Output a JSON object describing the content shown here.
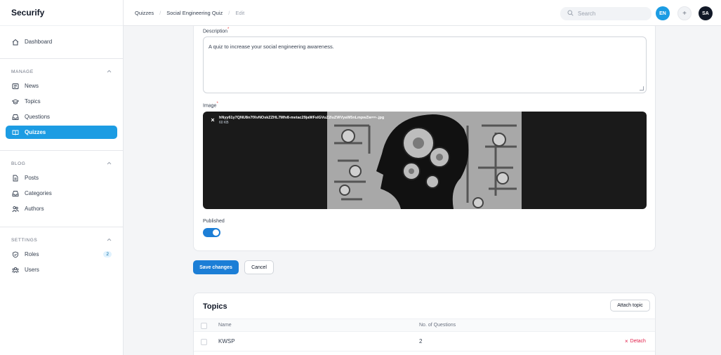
{
  "app": {
    "brand": "Securify"
  },
  "sidebar": {
    "dashboard": "Dashboard",
    "groups": [
      {
        "label": "MANAGE",
        "items": [
          "News",
          "Topics",
          "Questions",
          "Quizzes"
        ]
      },
      {
        "label": "BLOG",
        "items": [
          "Posts",
          "Categories",
          "Authors"
        ]
      },
      {
        "label": "SETTINGS",
        "items": [
          "Roles",
          "Users"
        ]
      }
    ],
    "roles_badge": "2",
    "active_item": "Quizzes"
  },
  "topbar": {
    "breadcrumbs": [
      "Quizzes",
      "Social Engineering Quiz",
      "Edit"
    ],
    "search_placeholder": "Search",
    "locale": "EN",
    "plus": "+",
    "user_initials": "SA",
    "colors": {
      "locale_bg": "#1c9ce3",
      "user_bg": "#111827"
    }
  },
  "form": {
    "description_label": "Description",
    "description_value": "A quiz to increase your social engineering awareness.",
    "image_label": "Image",
    "image_file_name": "hNyy61y7QNU8n7fXvNOskZZHL7Mfv8-metac29jaWFsIGVuZ2luZWVyaW5nLmpwZw==-.jpg",
    "image_file_size": "60 KB",
    "published_label": "Published",
    "published": true,
    "required_mark": "*"
  },
  "actions": {
    "save": "Save changes",
    "cancel": "Cancel"
  },
  "topics": {
    "title": "Topics",
    "attach": "Attach topic",
    "columns": [
      "Name",
      "No. of Questions"
    ],
    "rows": [
      {
        "name": "KWSP",
        "questions": "2",
        "action": "Detach"
      }
    ]
  },
  "colors": {
    "accent": "#1c9ce3",
    "primary_button": "#1c7ed6",
    "danger": "#e11d48"
  }
}
